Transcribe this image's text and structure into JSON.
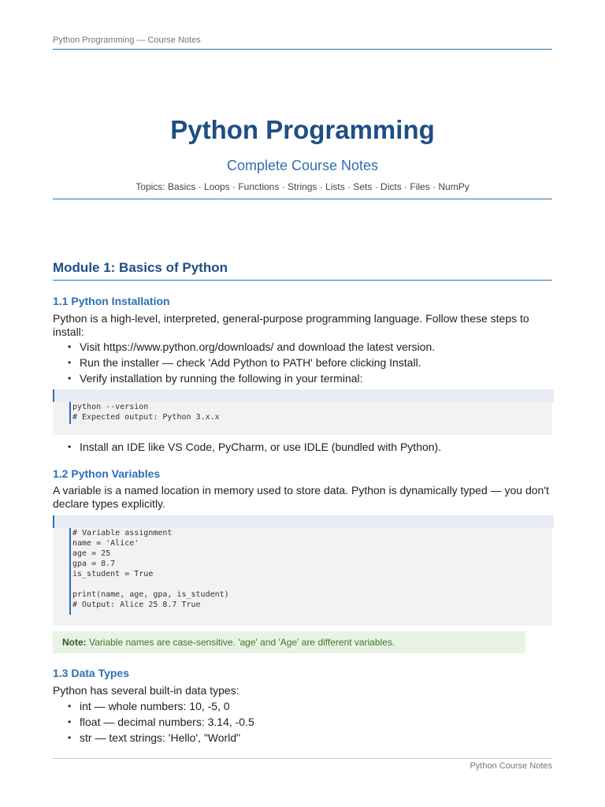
{
  "header": {
    "running_title": "Python Programming — Course Notes"
  },
  "title_block": {
    "title": "Python Programming",
    "subtitle": "Complete Course Notes",
    "topics": "Topics: Basics · Loops · Functions · Strings · Lists · Sets · Dicts · Files · NumPy"
  },
  "module1": {
    "title": "Module 1: Basics of Python",
    "s1": {
      "title": "1.1 Python Installation",
      "intro": "Python is a high-level, interpreted, general-purpose programming language. Follow these steps to install:",
      "steps": [
        "Visit https://www.python.org/downloads/ and download the latest version.",
        "Run the installer — check 'Add Python to PATH' before clicking Install.",
        "Verify installation by running the following in your terminal:"
      ],
      "code": [
        "python --version",
        "# Expected output: Python 3.x.x"
      ],
      "after": [
        "Install an IDE like VS Code, PyCharm, or use IDLE (bundled with Python)."
      ]
    },
    "s2": {
      "title": "1.2 Python Variables",
      "intro": "A variable is a named location in memory used to store data. Python is dynamically typed — you don't declare types explicitly.",
      "code": [
        "# Variable assignment",
        "name = 'Alice'",
        "age = 25",
        "gpa = 8.7",
        "is_student = True",
        "",
        "print(name, age, gpa, is_student)",
        "# Output: Alice 25 8.7 True"
      ],
      "note_label": "Note:",
      "note_text": " Variable names are case-sensitive. 'age' and 'Age' are different variables."
    },
    "s3": {
      "title": "1.3 Data Types",
      "intro": "Python has several built-in data types:",
      "items": [
        "int — whole numbers: 10, -5, 0",
        "float — decimal numbers: 3.14, -0.5",
        "str — text strings: 'Hello', \"World\""
      ]
    }
  },
  "footer": {
    "text": "Python Course Notes"
  },
  "colors": {
    "heading_dark": "#1f4e86",
    "heading_accent": "#2e6fb3",
    "code_bg": "#f2f2f2",
    "note_bg": "#e8f3e4",
    "note_text": "#3a7a2e"
  }
}
